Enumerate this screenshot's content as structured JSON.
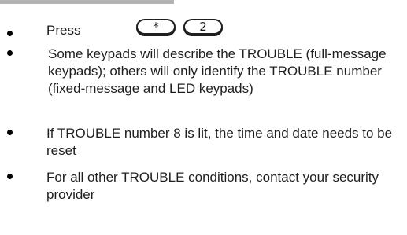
{
  "colors": {
    "text": "#1f1f1f",
    "bullet": "#000000",
    "top_band": "#b4b4b4"
  },
  "instructions": {
    "press_label": "Press",
    "keys": [
      "*",
      "2"
    ],
    "items": [
      "Some keypads will describe the TROUBLE (full-message keypads); others will only identify the TROUBLE number (fixed-message and LED keypads)",
      "If TROUBLE number 8 is lit, the time and date needs to be reset",
      "For all other TROUBLE conditions, contact your security provider"
    ]
  }
}
